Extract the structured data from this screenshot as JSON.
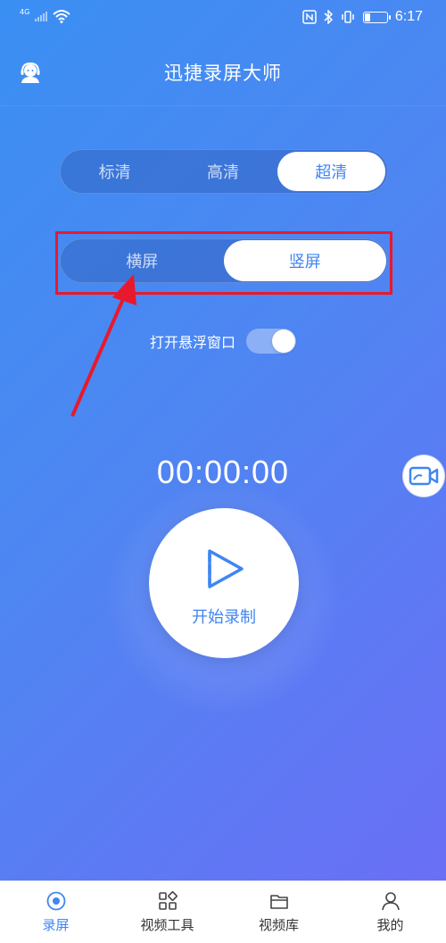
{
  "status_bar": {
    "network": "4G",
    "time": "6:17"
  },
  "header": {
    "title": "迅捷录屏大师"
  },
  "quality": {
    "options": [
      "标清",
      "高清",
      "超清"
    ],
    "selected": "超清"
  },
  "orientation": {
    "options": [
      "横屏",
      "竖屏"
    ],
    "selected": "竖屏"
  },
  "floating_window": {
    "label": "打开悬浮窗口",
    "enabled": true
  },
  "timer": "00:00:00",
  "record": {
    "label": "开始录制"
  },
  "bottom_nav": {
    "items": [
      {
        "label": "录屏",
        "icon": "record-disc-icon",
        "active": true
      },
      {
        "label": "视频工具",
        "icon": "tools-grid-icon",
        "active": false
      },
      {
        "label": "视频库",
        "icon": "folder-icon",
        "active": false
      },
      {
        "label": "我的",
        "icon": "person-icon",
        "active": false
      }
    ]
  },
  "colors": {
    "accent": "#3f86f2",
    "annotation": "#e8192c"
  }
}
